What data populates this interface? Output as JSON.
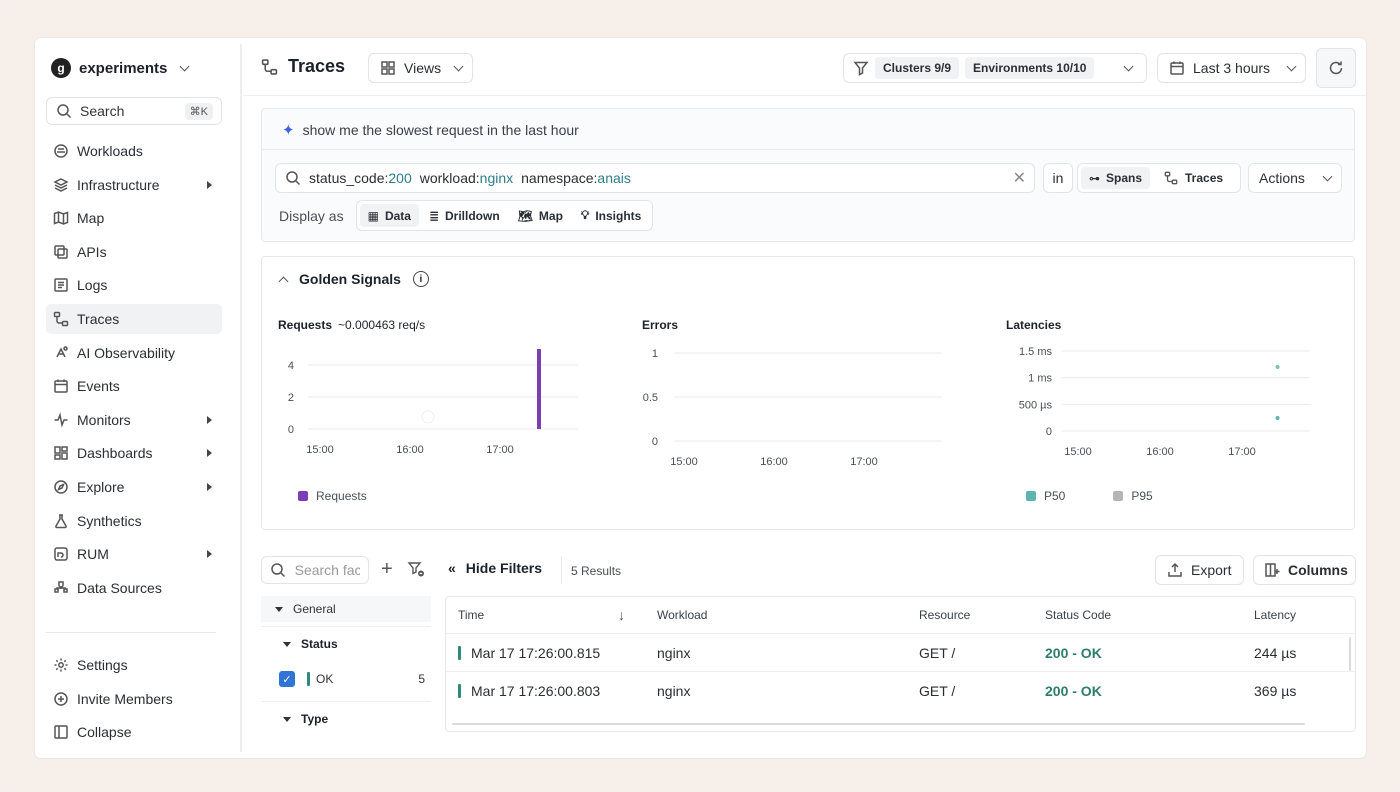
{
  "sidebar": {
    "workspace": {
      "logo_letter": "g",
      "name": "experiments"
    },
    "search": {
      "label": "Search",
      "shortcut": "⌘K"
    },
    "items": [
      {
        "label": "Workloads",
        "icon": "workloads-icon",
        "submenu": false
      },
      {
        "label": "Infrastructure",
        "icon": "infrastructure-icon",
        "submenu": true
      },
      {
        "label": "Map",
        "icon": "map-icon",
        "submenu": false
      },
      {
        "label": "APIs",
        "icon": "apis-icon",
        "submenu": false
      },
      {
        "label": "Logs",
        "icon": "logs-icon",
        "submenu": false
      },
      {
        "label": "Traces",
        "icon": "traces-icon",
        "submenu": false,
        "active": true
      },
      {
        "label": "AI Observability",
        "icon": "ai-observability-icon",
        "submenu": false
      },
      {
        "label": "Events",
        "icon": "events-icon",
        "submenu": false
      },
      {
        "label": "Monitors",
        "icon": "monitors-icon",
        "submenu": true
      },
      {
        "label": "Dashboards",
        "icon": "dashboards-icon",
        "submenu": true
      },
      {
        "label": "Explore",
        "icon": "explore-icon",
        "submenu": true
      },
      {
        "label": "Synthetics",
        "icon": "synthetics-icon",
        "submenu": false
      },
      {
        "label": "RUM",
        "icon": "rum-icon",
        "submenu": true
      },
      {
        "label": "Data Sources",
        "icon": "data-sources-icon",
        "submenu": false
      }
    ],
    "bottom": [
      {
        "label": "Settings",
        "icon": "settings-icon"
      },
      {
        "label": "Invite Members",
        "icon": "invite-icon"
      },
      {
        "label": "Collapse",
        "icon": "collapse-icon"
      }
    ]
  },
  "header": {
    "title": "Traces",
    "views_label": "Views",
    "clusters": "Clusters 9/9",
    "environments": "Environments 10/10",
    "time_range": "Last 3 hours"
  },
  "query": {
    "ai_prompt": "show me the slowest request in the last hour",
    "tokens": [
      {
        "key": "status_code:",
        "value": "200"
      },
      {
        "key": "workload:",
        "value": "nginx"
      },
      {
        "key": "namespace:",
        "value": "anais"
      }
    ],
    "in_label": "in",
    "spans_label": "Spans",
    "traces_label": "Traces",
    "actions_label": "Actions",
    "display_as_label": "Display as",
    "display_options": [
      "Data",
      "Drilldown",
      "Map",
      "Insights"
    ]
  },
  "golden_signals": {
    "title": "Golden Signals",
    "requests": {
      "title": "Requests",
      "rate": "~0.000463 req/s",
      "legend": "Requests",
      "color": "#7b3fb5"
    },
    "errors": {
      "title": "Errors"
    },
    "latencies": {
      "title": "Latencies",
      "legend_p50": "P50",
      "legend_p95": "P95",
      "p50_color": "#5cb3b0",
      "p95_color": "#b5b5b5"
    }
  },
  "chart_data": [
    {
      "type": "bar",
      "title": "Requests",
      "x_ticks": [
        "15:00",
        "16:00",
        "17:00"
      ],
      "y_ticks": [
        0,
        2,
        4
      ],
      "ylim": [
        0,
        4.5
      ],
      "series": [
        {
          "name": "Requests",
          "points": [
            {
              "x": "17:26",
              "y": 5
            }
          ]
        }
      ]
    },
    {
      "type": "line",
      "title": "Errors",
      "x_ticks": [
        "15:00",
        "16:00",
        "17:00"
      ],
      "y_ticks": [
        "0",
        "0.5",
        "1"
      ],
      "ylim": [
        0,
        1
      ],
      "series": []
    },
    {
      "type": "scatter",
      "title": "Latencies",
      "x_ticks": [
        "15:00",
        "16:00",
        "17:00"
      ],
      "y_ticks": [
        "0",
        "500 µs",
        "1 ms",
        "1.5 ms"
      ],
      "series": [
        {
          "name": "P50",
          "points": [
            {
              "x": "17:26",
              "y_us": 244
            }
          ]
        },
        {
          "name": "P95",
          "points": [
            {
              "x": "17:26",
              "y_us": 1200
            }
          ]
        }
      ]
    }
  ],
  "results": {
    "filter_search_placeholder": "Search fac",
    "hide_filters_label": "Hide Filters",
    "count_label": "5 Results",
    "export_label": "Export",
    "columns_label": "Columns",
    "filter_groups": {
      "general": "General",
      "status": "Status",
      "type": "Type"
    },
    "status_filter": {
      "label": "OK",
      "count": "5",
      "checked": true
    },
    "columns": [
      "Time",
      "Workload",
      "Resource",
      "Status Code",
      "Latency"
    ],
    "rows": [
      {
        "time": "Mar 17 17:26:00.815",
        "workload": "nginx",
        "resource": "GET /",
        "status": "200 - OK",
        "latency": "244 µs"
      },
      {
        "time": "Mar 17 17:26:00.803",
        "workload": "nginx",
        "resource": "GET /",
        "status": "200 - OK",
        "latency": "369 µs"
      }
    ]
  }
}
